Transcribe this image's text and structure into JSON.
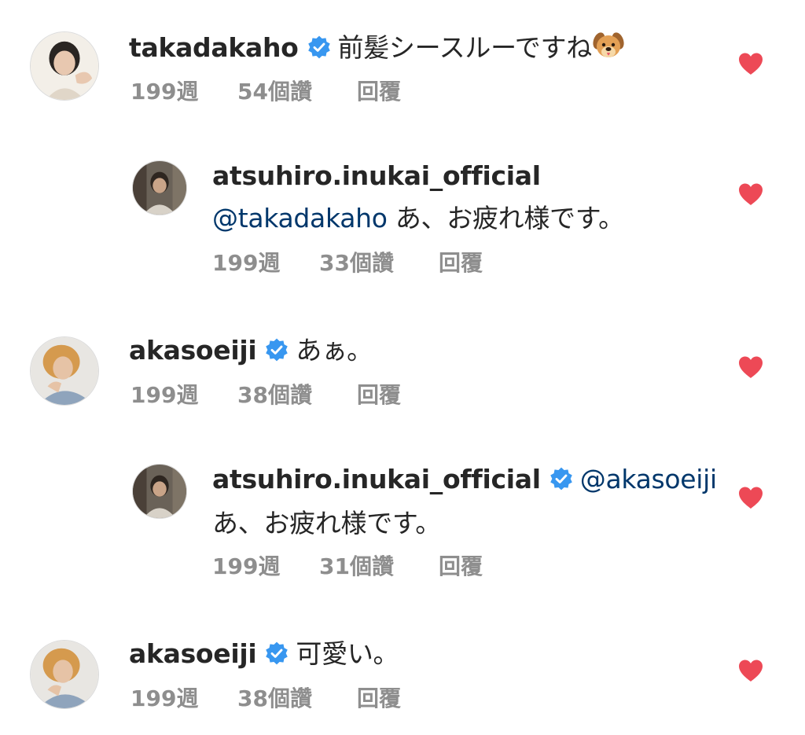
{
  "colors": {
    "username": "#262626",
    "mention": "#00376b",
    "meta": "#8e8e8e",
    "verified": "#3897f0",
    "heart": "#ed4956"
  },
  "comments": [
    {
      "username": "takadakaho",
      "verified": true,
      "mention": "",
      "text": "前髪シースルーですね",
      "emoji": "dog-face",
      "time": "199週",
      "likes": "54個讚",
      "reply_label": "回覆",
      "liked": true
    },
    {
      "username": "atsuhiro.inukai_official",
      "verified": false,
      "mention": "@takadakaho",
      "text": "あ、お疲れ様です。",
      "time": "199週",
      "likes": "33個讚",
      "reply_label": "回覆",
      "liked": true
    },
    {
      "username": "akasoeiji",
      "verified": true,
      "mention": "",
      "text": "あぁ。",
      "time": "199週",
      "likes": "38個讚",
      "reply_label": "回覆",
      "liked": true
    },
    {
      "username": "atsuhiro.inukai_official",
      "verified": true,
      "mention": "@akasoeiji",
      "text": "あ、お疲れ様です。",
      "time": "199週",
      "likes": "31個讚",
      "reply_label": "回覆",
      "liked": true
    },
    {
      "username": "akasoeiji",
      "verified": true,
      "mention": "",
      "text": "可愛い。",
      "time": "199週",
      "likes": "38個讚",
      "reply_label": "回覆",
      "liked": true
    }
  ]
}
